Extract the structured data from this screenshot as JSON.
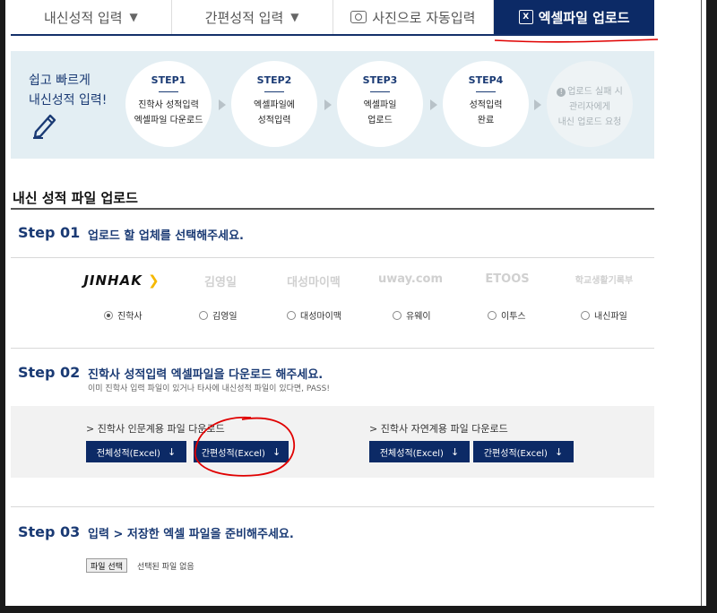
{
  "tabs": [
    {
      "label": "내신성적 입력",
      "caret": "▼"
    },
    {
      "label": "간편성적 입력",
      "caret": "▼"
    },
    {
      "label": "사진으로 자동입력"
    },
    {
      "label": "엑셀파일 업로드",
      "icon_text": "X"
    }
  ],
  "banner": {
    "title_line1": "쉽고 빠르게",
    "title_line2": "내신성적 입력!",
    "steps": [
      {
        "step": "STEP1",
        "line1": "진학사 성적입력",
        "line2": "엑셀파일 다운로드"
      },
      {
        "step": "STEP2",
        "line1": "엑셀파일에",
        "line2": "성적입력"
      },
      {
        "step": "STEP3",
        "line1": "엑셀파일",
        "line2": "업로드"
      },
      {
        "step": "STEP4",
        "line1": "성적입력",
        "line2": "완료"
      }
    ],
    "fail": {
      "line1": "업로드 실패 시",
      "line2": "관리자에게",
      "line3": "내신 업로드 요청",
      "icon": "!"
    }
  },
  "section_title": "내신 성적 파일 업로드",
  "step01": {
    "label": "Step 01",
    "desc": "업로드 할 업체를 선택해주세요.",
    "logos": [
      "JINHAK",
      "김영일",
      "대성마이맥",
      "uway.com",
      "ETOOS",
      "학교생활기록부"
    ],
    "options": [
      "진학사",
      "김영일",
      "대성마이맥",
      "유웨이",
      "이투스",
      "내신파일"
    ],
    "selected_index": 0
  },
  "step02": {
    "label": "Step 02",
    "desc": "진학사 성적입력 엑셀파일을 다운로드 해주세요.",
    "sub": "이미 진학사 입력 파일이 있거나 타사에 내신성적 파일이 있다면, PASS!",
    "humanities": {
      "title": "> 진학사 인문계용 파일 다운로드",
      "btn_full": "전체성적(Excel)",
      "btn_simple": "간편성적(Excel)"
    },
    "science": {
      "title": "> 진학사 자연계용 파일 다운로드",
      "btn_full": "전체성적(Excel)",
      "btn_simple": "간편성적(Excel)"
    },
    "download_glyph": "↓"
  },
  "step03": {
    "label": "Step 03",
    "desc": "입력 > 저장한 엑셀 파일을 준비해주세요.",
    "file_button": "파일 선택",
    "file_status": "선택된 파일 없음"
  },
  "colors": {
    "navy": "#0c2a66",
    "accent_red": "#e00000",
    "banner_bg": "#e3eef3"
  }
}
